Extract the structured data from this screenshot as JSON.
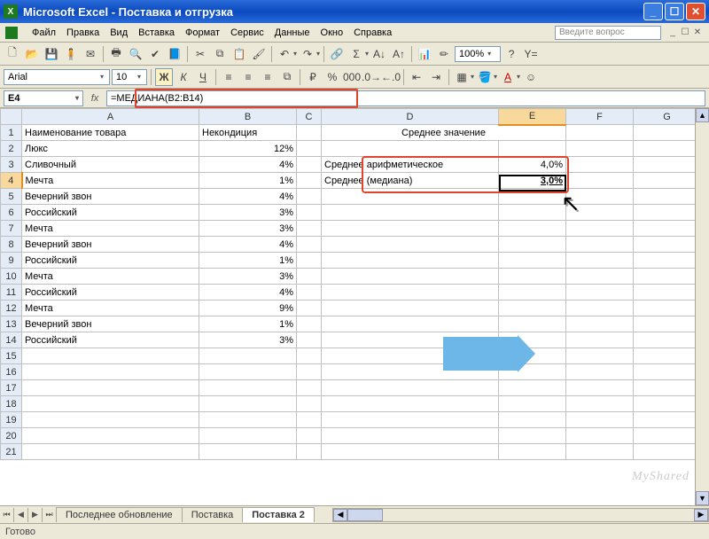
{
  "titlebar": {
    "app": "Microsoft Excel",
    "doc": "Поставка и отгрузка"
  },
  "menu": {
    "file": "Файл",
    "edit": "Правка",
    "view": "Вид",
    "insert": "Вставка",
    "format": "Формат",
    "tools": "Сервис",
    "data": "Данные",
    "window": "Окно",
    "help": "Справка",
    "help_placeholder": "Введите вопрос"
  },
  "format_bar": {
    "font": "Arial",
    "size": "10",
    "zoom": "100%"
  },
  "formula": {
    "cell_ref": "E4",
    "text": "=МЕДИАНА(B2:B14)"
  },
  "columns": [
    "A",
    "B",
    "C",
    "D",
    "E",
    "F",
    "G"
  ],
  "active_col_index": 4,
  "active_row": 4,
  "headers_row": {
    "A": "Наименование товара",
    "B": "Некондиция",
    "D": "Среднее значение"
  },
  "data_rows": [
    {
      "n": 2,
      "A": "Люкс",
      "B": "12%"
    },
    {
      "n": 3,
      "A": "Сливочный",
      "B": "4%",
      "D": "Среднее арифметическое",
      "E": "4,0%"
    },
    {
      "n": 4,
      "A": "Мечта",
      "B": "1%",
      "D": "Среднее (медиана)",
      "E": "3,0%"
    },
    {
      "n": 5,
      "A": "Вечерний звон",
      "B": "4%"
    },
    {
      "n": 6,
      "A": "Российский",
      "B": "3%"
    },
    {
      "n": 7,
      "A": "Мечта",
      "B": "3%"
    },
    {
      "n": 8,
      "A": "Вечерний звон",
      "B": "4%"
    },
    {
      "n": 9,
      "A": "Российский",
      "B": "1%"
    },
    {
      "n": 10,
      "A": "Мечта",
      "B": "3%"
    },
    {
      "n": 11,
      "A": "Российский",
      "B": "4%"
    },
    {
      "n": 12,
      "A": "Мечта",
      "B": "9%"
    },
    {
      "n": 13,
      "A": "Вечерний звон",
      "B": "1%"
    },
    {
      "n": 14,
      "A": "Российский",
      "B": "3%"
    }
  ],
  "empty_rows": [
    15,
    16,
    17,
    18,
    19,
    20,
    21
  ],
  "tabs": {
    "nav": [
      "⏮",
      "◀",
      "▶",
      "⏭"
    ],
    "sheets": [
      "Последнее обновление",
      "Поставка",
      "Поставка 2"
    ],
    "active": 2
  },
  "status": "Готово",
  "watermark": "MyShared"
}
